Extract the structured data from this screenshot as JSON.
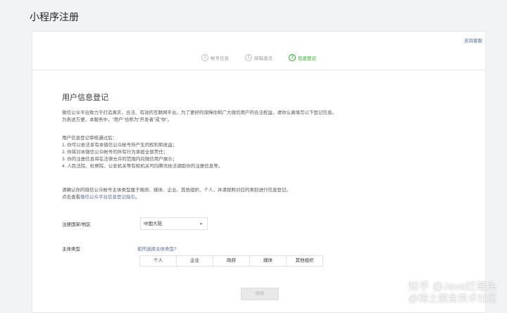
{
  "page_title": "小程序注册",
  "help_link": "咨询客服",
  "steps": [
    {
      "num": "1",
      "label": "帐号信息",
      "active": false
    },
    {
      "num": "2",
      "label": "邮箱激活",
      "active": false
    },
    {
      "num": "3",
      "label": "信息登记",
      "active": true
    }
  ],
  "section_title": "用户信息登记",
  "intro": {
    "line1": "微信公众平台致力于打造真实、合法、有效的互联网平台。为了更好的保障你和广大微信用户的合法权益，请你认真填写以下登记信息。",
    "line2": "为表述方便，本服务中，“用户”也称为“开发者”或“你”。"
  },
  "rights": {
    "heading": "用户信息登记审核通过后：",
    "items": [
      "1. 你可以依法享有本微信公众帐号所产生的权利和收益；",
      "2. 你将对本微信公众帐号的所有行为承担全部责任；",
      "3. 你的注册信息将在法律允许的范围内向微信用户展示；",
      "4. 人民法院、检察院、公安机关等有权机关可向腾讯依法调取你的注册信息等。"
    ]
  },
  "confirm": {
    "line1": "请确认你的微信公众帐号主体类型属于政府、媒体、企业、其他组织、个人，并请按照对应的类别进行信息登记。",
    "line2_prefix": "点击查看",
    "line2_link": "微信公众平台信息登记指引",
    "line2_suffix": "。"
  },
  "form": {
    "region_label": "注册国家/地区",
    "region_value": "中国大陆",
    "type_label": "主体类型",
    "type_help_link": "如何选择主体类型?",
    "types": [
      "个人",
      "企业",
      "政府",
      "媒体",
      "其他组织"
    ]
  },
  "continue_label": "继续",
  "watermark": {
    "line1": "知乎 @Java烂笔头",
    "line2": "@稀土掘金技术社区"
  }
}
